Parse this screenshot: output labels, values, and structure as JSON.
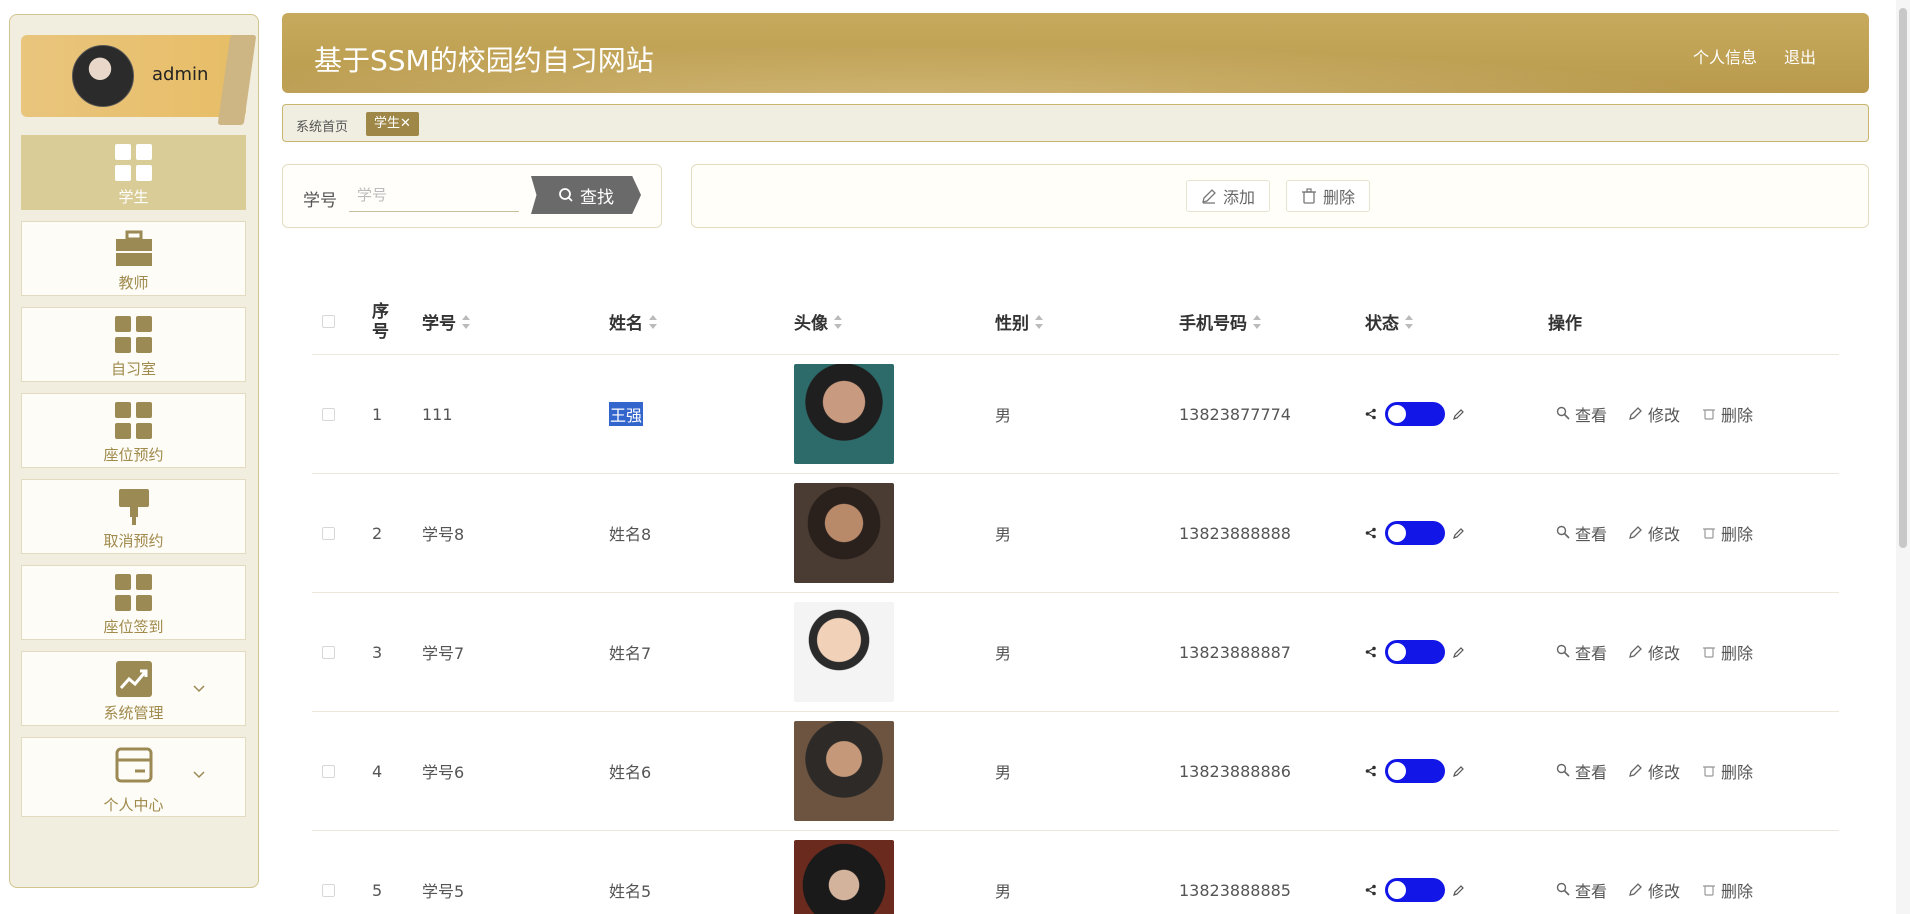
{
  "user": {
    "name": "admin"
  },
  "sidebar": {
    "items": [
      {
        "label": "学生",
        "icon": "grid-icon",
        "active": true
      },
      {
        "label": "教师",
        "icon": "briefcase-icon"
      },
      {
        "label": "自习室",
        "icon": "grid-icon"
      },
      {
        "label": "座位预约",
        "icon": "grid-icon"
      },
      {
        "label": "取消预约",
        "icon": "brush-icon"
      },
      {
        "label": "座位签到",
        "icon": "grid-icon"
      },
      {
        "label": "系统管理",
        "icon": "chart-icon",
        "expandable": true
      },
      {
        "label": "个人中心",
        "icon": "wallet-icon",
        "expandable": true
      }
    ]
  },
  "header": {
    "title": "基于SSM的校园约自习网站",
    "profile_link": "个人信息",
    "logout_link": "退出"
  },
  "tabs": {
    "home": "系统首页",
    "active": "学生"
  },
  "search": {
    "label": "学号",
    "placeholder": "学号",
    "button": "查找"
  },
  "actions": {
    "add": "添加",
    "delete": "删除"
  },
  "table": {
    "columns": {
      "index": "序号",
      "student_id": "学号",
      "name": "姓名",
      "avatar": "头像",
      "gender": "性别",
      "phone": "手机号码",
      "status": "状态",
      "operations": "操作"
    },
    "op_labels": {
      "view": "查看",
      "edit": "修改",
      "delete": "删除"
    },
    "rows": [
      {
        "index": "1",
        "student_id": "111",
        "name": "王强",
        "gender": "男",
        "phone": "13823877774",
        "status_on": true
      },
      {
        "index": "2",
        "student_id": "学号8",
        "name": "姓名8",
        "gender": "男",
        "phone": "13823888888",
        "status_on": true
      },
      {
        "index": "3",
        "student_id": "学号7",
        "name": "姓名7",
        "gender": "男",
        "phone": "13823888887",
        "status_on": true
      },
      {
        "index": "4",
        "student_id": "学号6",
        "name": "姓名6",
        "gender": "男",
        "phone": "13823888886",
        "status_on": true
      },
      {
        "index": "5",
        "student_id": "学号5",
        "name": "姓名5",
        "gender": "男",
        "phone": "13823888885",
        "status_on": true
      }
    ]
  },
  "colors": {
    "accent": "#b99a4d",
    "switch_on": "#1216e6",
    "sidebar_bg": "#f1eedf"
  }
}
